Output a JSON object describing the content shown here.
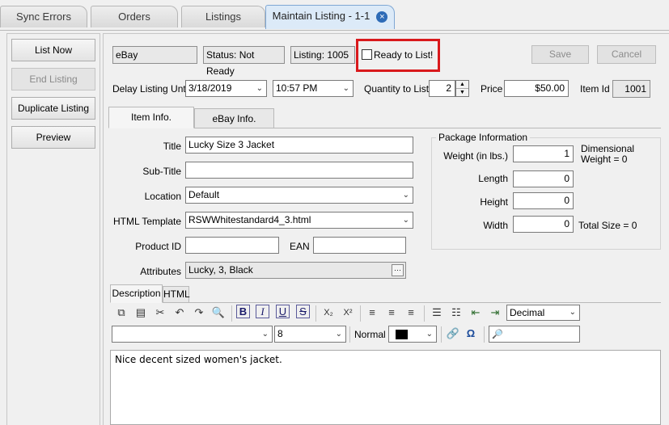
{
  "tabs": [
    {
      "label": "Sync Errors"
    },
    {
      "label": "Orders"
    },
    {
      "label": "Listings"
    },
    {
      "label": "Maintain Listing - 1-1",
      "close": "×"
    }
  ],
  "left_buttons": {
    "list_now": "List Now",
    "end_listing": "End Listing",
    "duplicate_listing": "Duplicate Listing",
    "preview": "Preview"
  },
  "header": {
    "channel": "eBay",
    "status": "Status: Not Ready",
    "listing": "Listing: 1005",
    "ready_label": "Ready to List!",
    "save": "Save",
    "cancel": "Cancel"
  },
  "row2": {
    "delay_label": "Delay Listing Until",
    "date": "3/18/2019",
    "time": "10:57 PM",
    "qty_label": "Quantity to List",
    "qty": "2",
    "price_label": "Price",
    "price": "$50.00",
    "itemid_label": "Item Id",
    "itemid": "1001"
  },
  "subtabs": {
    "item_info": "Item Info.",
    "ebay_info": "eBay Info."
  },
  "item": {
    "title_label": "Title",
    "title": "Lucky Size 3 Jacket",
    "subtitle_label": "Sub-Title",
    "subtitle": "",
    "location_label": "Location",
    "location": "Default",
    "template_label": "HTML Template",
    "template": "RSWWhitestandard4_3.html",
    "product_id_label": "Product ID",
    "product_id": "",
    "ean_label": "EAN",
    "ean": "",
    "attributes_label": "Attributes",
    "attributes": "Lucky, 3, Black",
    "attributes_button": "···"
  },
  "package": {
    "legend": "Package Information",
    "weight_label": "Weight (in lbs.)",
    "weight": "1",
    "dimensional_line1": "Dimensional",
    "dimensional_line2": "Weight = 0",
    "length_label": "Length",
    "length": "0",
    "height_label": "Height",
    "height": "0",
    "width_label": "Width",
    "width": "0",
    "total_size": "Total Size = 0"
  },
  "editor": {
    "tab_description": "Description",
    "tab_html": "HTML",
    "list_style": "Decimal",
    "font_family": "",
    "font_size": "8",
    "paragraph_style": "Normal",
    "font_color": "#000000",
    "content": "Nice decent sized women's jacket."
  },
  "colors": {
    "highlight": "#d9191c",
    "active_tab": "#dceaf8"
  }
}
